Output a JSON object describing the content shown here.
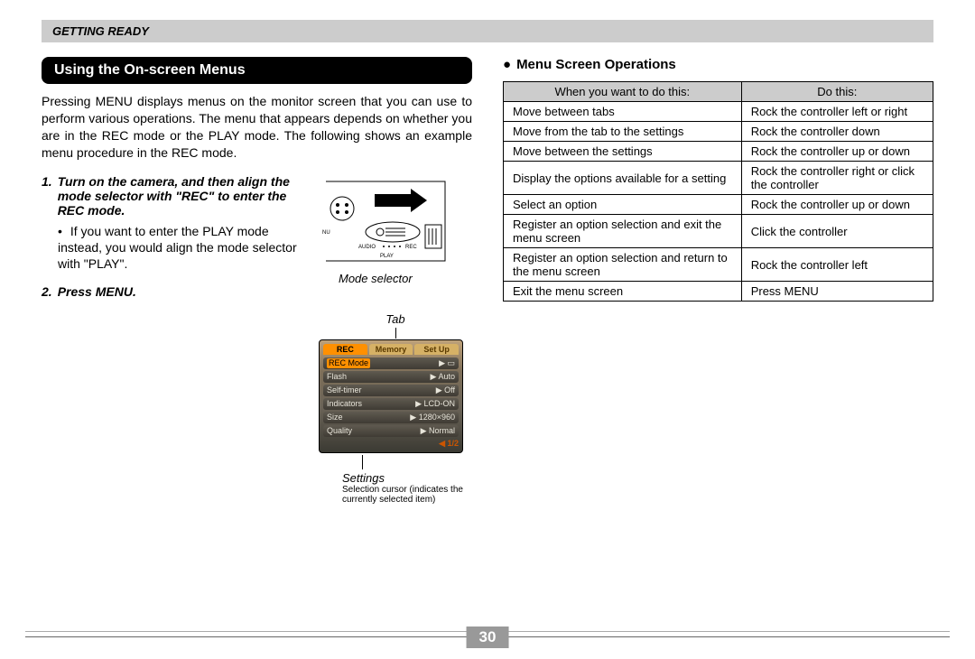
{
  "header": {
    "section": "GETTING READY"
  },
  "left": {
    "title": "Using the On-screen Menus",
    "intro": "Pressing MENU displays menus on the monitor screen that you can use to perform various operations. The menu that appears depends on whether you are in the REC mode or the PLAY mode. The following shows an example menu procedure in the REC mode.",
    "step1_num": "1.",
    "step1": "Turn on the camera, and then align the mode selector with \"REC\" to enter the REC mode.",
    "step1_note": "If you want to enter the PLAY mode instead, you would align the mode selector with \"PLAY\".",
    "step2_num": "2.",
    "step2": "Press MENU.",
    "fig1_caption": "Mode selector",
    "fig1_labels": {
      "nu": "NU",
      "audio": "AUDIO",
      "rec": "REC",
      "play": "PLAY"
    },
    "fig2": {
      "tab_caption": "Tab",
      "tabs": [
        "REC",
        "Memory",
        "Set Up"
      ],
      "settings": [
        {
          "k": "REC Mode",
          "v": "▶ ▭"
        },
        {
          "k": "Flash",
          "v": "▶ Auto"
        },
        {
          "k": "Self-timer",
          "v": "▶ Off"
        },
        {
          "k": "Indicators",
          "v": "▶ LCD-ON"
        },
        {
          "k": "Size",
          "v": "▶ 1280×960"
        },
        {
          "k": "Quality",
          "v": "▶ Normal"
        }
      ],
      "page_ind": "◀ 1/2",
      "settings_caption": "Settings",
      "selcur_caption": "Selection cursor (indicates the currently selected item)"
    }
  },
  "right": {
    "heading": "Menu Screen Operations",
    "th_left": "When you want to do this:",
    "th_right": "Do this:",
    "rows": [
      {
        "want": "Move between tabs",
        "do": "Rock the controller left or right"
      },
      {
        "want": "Move from the tab to the settings",
        "do": "Rock the controller down"
      },
      {
        "want": "Move between the settings",
        "do": "Rock the controller up or down"
      },
      {
        "want": "Display the options available for a setting",
        "do": "Rock the controller right or click the controller"
      },
      {
        "want": "Select an option",
        "do": "Rock the controller up or down"
      },
      {
        "want": "Register an option selection and exit the menu screen",
        "do": "Click the controller"
      },
      {
        "want": "Register an option selection and return to the menu screen",
        "do": "Rock the controller left"
      },
      {
        "want": "Exit the menu screen",
        "do": "Press MENU"
      }
    ]
  },
  "page_number": "30"
}
